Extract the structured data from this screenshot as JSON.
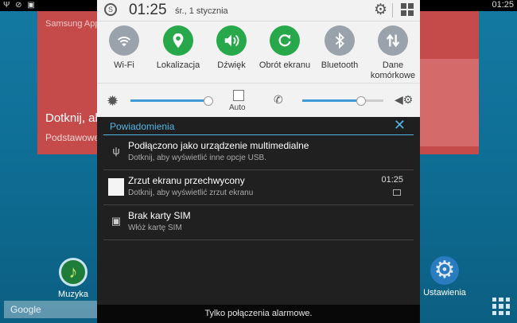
{
  "status_bar": {
    "left_icons": "Ψ ⊘ ▣",
    "time": "01:25"
  },
  "widget": {
    "app_name": "Samsung Apps",
    "text": "Dotknij, aby",
    "subtext": "Podstawowe"
  },
  "home": {
    "apps": [
      {
        "label": "Muzyka",
        "color": "#1f7d3a"
      },
      {
        "label": "Ustawienia",
        "color": "#2a7cc0"
      }
    ],
    "search_label": "Google"
  },
  "quick_settings": {
    "time": "01:25",
    "date": "śr., 1 stycznia",
    "toggles": [
      {
        "label": "Wi-Fi",
        "state": "off",
        "icon": "wifi-icon"
      },
      {
        "label": "Lokalizacja",
        "state": "on",
        "icon": "location-icon"
      },
      {
        "label": "Dźwięk",
        "state": "on",
        "icon": "sound-icon"
      },
      {
        "label": "Obrót ekranu",
        "state": "on",
        "icon": "rotate-icon"
      },
      {
        "label": "Bluetooth",
        "state": "off",
        "icon": "bluetooth-icon"
      },
      {
        "label": "Dane komórkowe",
        "state": "off",
        "icon": "mobile-data-icon"
      }
    ],
    "brightness_level": 0.97,
    "auto_label": "Auto",
    "volume_level": 0.72
  },
  "notifications": {
    "header": "Powiadomienia",
    "items": [
      {
        "title": "Podłączono jako urządzenie multimedialne",
        "subtitle": "Dotknij, aby wyświetlić inne opcje USB.",
        "time": "",
        "icon": "usb-icon"
      },
      {
        "title": "Zrzut ekranu przechwycony",
        "subtitle": "Dotknij, aby wyświetlić zrzut ekranu",
        "time": "01:25",
        "icon": "screenshot-thumbnail"
      },
      {
        "title": "Brak karty SIM",
        "subtitle": "Włóż kartę SIM",
        "time": "",
        "icon": "sim-icon"
      }
    ]
  },
  "footer": {
    "text": "Tylko połączenia alarmowe."
  },
  "colors": {
    "accent": "#53b5e6",
    "toggle_on": "#27a84a",
    "toggle_off": "#9aa3ab",
    "slider": "#3d9ad6"
  }
}
